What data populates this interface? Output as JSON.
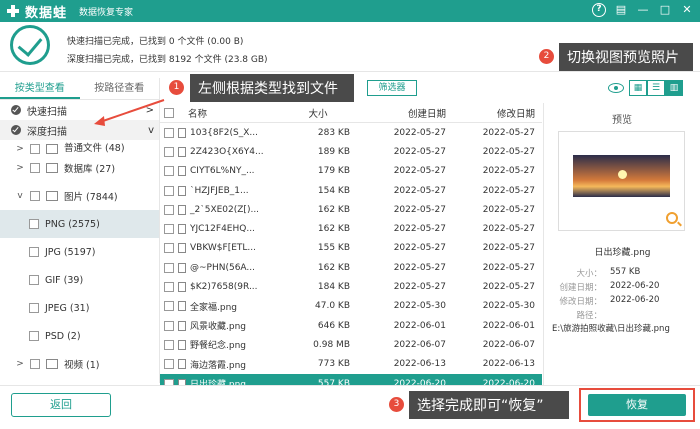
{
  "app": {
    "logo_text": "数据蛙",
    "subtitle": "数据恢复专家"
  },
  "window_controls": {
    "help": "?",
    "save": "▤",
    "minimize": "—",
    "maximize": "□",
    "close": "✕"
  },
  "scan": {
    "quick_line": "快速扫描已完成，已找到  0 个文件  (0.00  B)",
    "deep_line": "深度扫描已完成，已找到  8192 个文件 (23.8 GB)"
  },
  "callouts": {
    "c1_num": "1",
    "c1_text": "左侧根据类型找到文件",
    "c2_num": "2",
    "c2_text": "切换视图预览照片",
    "c3_num": "3",
    "c3_text": "选择完成即可“恢复”"
  },
  "sidebar": {
    "tabs": [
      "按类型查看",
      "按路径查看"
    ],
    "quick_scan": "快速扫描",
    "deep_scan": "深度扫描",
    "tree": [
      {
        "label": "普通文件 (48)",
        "twisty": ">"
      },
      {
        "label": "数据库 (27)",
        "twisty": ">"
      },
      {
        "label": "图片 (7844)",
        "twisty": "v"
      },
      {
        "label": "PNG (2575)",
        "twisty": ""
      },
      {
        "label": "JPG (5197)",
        "twisty": ""
      },
      {
        "label": "GIF (39)",
        "twisty": ""
      },
      {
        "label": "JPEG (31)",
        "twisty": ""
      },
      {
        "label": "PSD (2)",
        "twisty": ""
      },
      {
        "label": "视频 (1)",
        "twisty": ">"
      }
    ]
  },
  "toolbar": {
    "filter_label": "筛选器",
    "view_grid": "▦",
    "view_list": "☰",
    "view_detail": "▥"
  },
  "table": {
    "headers": {
      "name": "名称",
      "size": "大小",
      "created": "创建日期",
      "modified": "修改日期"
    },
    "rows": [
      {
        "name": "103{8F2(S_X...",
        "size": "283 KB",
        "created": "2022-05-27",
        "modified": "2022-05-27"
      },
      {
        "name": "2Z423O{X6Y4...",
        "size": "189 KB",
        "created": "2022-05-27",
        "modified": "2022-05-27"
      },
      {
        "name": "CIYT6L%NY_...",
        "size": "179 KB",
        "created": "2022-05-27",
        "modified": "2022-05-27"
      },
      {
        "name": "`HZJFJEB_1...",
        "size": "154 KB",
        "created": "2022-05-27",
        "modified": "2022-05-27"
      },
      {
        "name": "_2`5XE02(Z[)...",
        "size": "162 KB",
        "created": "2022-05-27",
        "modified": "2022-05-27"
      },
      {
        "name": "YJC12F4EHQ...",
        "size": "162 KB",
        "created": "2022-05-27",
        "modified": "2022-05-27"
      },
      {
        "name": "VBKW$F[ETL...",
        "size": "155 KB",
        "created": "2022-05-27",
        "modified": "2022-05-27"
      },
      {
        "name": "@~PHN(56A...",
        "size": "162 KB",
        "created": "2022-05-27",
        "modified": "2022-05-27"
      },
      {
        "name": "$K2)7658(9R...",
        "size": "184 KB",
        "created": "2022-05-27",
        "modified": "2022-05-27"
      },
      {
        "name": "全家福.png",
        "size": "47.0 KB",
        "created": "2022-05-30",
        "modified": "2022-05-30"
      },
      {
        "name": "风景收藏.png",
        "size": "646 KB",
        "created": "2022-06-01",
        "modified": "2022-06-01"
      },
      {
        "name": "野餐纪念.png",
        "size": "0.98 MB",
        "created": "2022-06-07",
        "modified": "2022-06-07"
      },
      {
        "name": "海边落霞.png",
        "size": "773 KB",
        "created": "2022-06-13",
        "modified": "2022-06-13"
      },
      {
        "name": "日出珍藏.png",
        "size": "557 KB",
        "created": "2022-06-20",
        "modified": "2022-06-20",
        "selected": true
      }
    ]
  },
  "preview": {
    "title": "预览",
    "filename": "日出珍藏.png",
    "size_label": "大小：",
    "size": "557 KB",
    "created_label": "创建日期：",
    "created": "2022-06-20",
    "modified_label": "修改日期：",
    "modified": "2022-06-20",
    "path_label": "路径：",
    "path": "E:\\旅游拍照收藏\\日出珍藏.png"
  },
  "footer": {
    "back_label": "返回",
    "recover_label": "恢复"
  },
  "colors": {
    "accent": "#1f9e8e",
    "callout_bg": "#4a4a4a",
    "badge": "#e74c3c"
  }
}
